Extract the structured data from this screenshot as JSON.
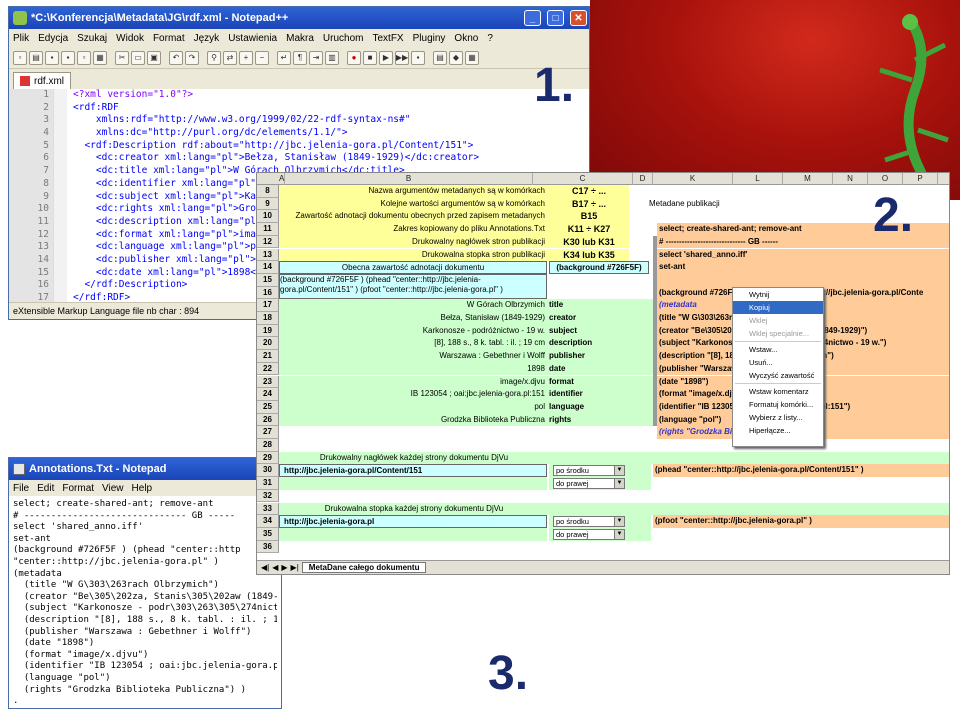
{
  "labels": {
    "n1": "1.",
    "n2": "2.",
    "n3": "3."
  },
  "npp": {
    "title": "*C:\\Konferencja\\Metadata\\JG\\rdf.xml - Notepad++",
    "menu": [
      "Plik",
      "Edycja",
      "Szukaj",
      "Widok",
      "Format",
      "Język",
      "Ustawienia",
      "Makra",
      "Uruchom",
      "TextFX",
      "Pluginy",
      "Okno",
      "?"
    ],
    "tab": "rdf.xml",
    "line_numbers": [
      "1",
      "2",
      "3",
      "4",
      "5",
      "6",
      "7",
      "8",
      "9",
      "10",
      "11",
      "12",
      "13",
      "14",
      "15",
      "16",
      "17"
    ],
    "lines": [
      "<?xml version=\"1.0\"?>",
      "<rdf:RDF",
      "    xmlns:rdf=\"http://www.w3.org/1999/02/22-rdf-syntax-ns#\"",
      "    xmlns:dc=\"http://purl.org/dc/elements/1.1/\">",
      "  <rdf:Description rdf:about=\"http://jbc.jelenia-gora.pl/Content/151\">",
      "    <dc:creator xml:lang=\"pl\">Bełza, Stanisław (1849-1929)</dc:creator>",
      "    <dc:title xml:lang=\"pl\">W Górach Olbrzymich</dc:title>",
      "    <dc:identifier xml:lang=\"pl\">",
      "    <dc:subject xml:lang=\"pl\">Kar",
      "    <dc:rights xml:lang=\"pl\">Grod",
      "    <dc:description xml:lang=\"pl\">",
      "    <dc:format xml:lang=\"pl\">imag",
      "    <dc:language xml:lang=\"pl\">po",
      "    <dc:publisher xml:lang=\"pl\">W",
      "    <dc:date xml:lang=\"pl\">1898</",
      "  </rdf:Description>",
      "</rdf:RDF>"
    ],
    "status": "eXtensible Markup Language file  nb char : 894"
  },
  "np": {
    "title": "Annotations.Txt - Notepad",
    "menu": [
      "File",
      "Edit",
      "Format",
      "View",
      "Help"
    ],
    "lines": [
      "select; create-shared-ant; remove-ant",
      "# ------------------------------ GB -----",
      "select 'shared_anno.iff'",
      "set-ant",
      "(background #726F5F ) (phead \"center::http",
      "\"center::http://jbc.jelenia-gora.pl\" )",
      "(metadata",
      "  (title \"W G\\303\\263rach Olbrzymich\")",
      "  (creator \"Be\\305\\202za, Stanis\\305\\202aw (1849-1929)\")",
      "  (subject \"Karkonosze - podr\\303\\263\\305\\274nictwo - 19 w.\")",
      "  (description \"[8], 188 s., 8 k. tabl. : il. ; 19 cm\")",
      "  (publisher \"Warszawa : Gebethner i Wolff\")",
      "  (date \"1898\")",
      "  (format \"image/x.djvu\")",
      "  (identifier \"IB 123054 ; oai:jbc.jelenia-gora.pl:151\")",
      "  (language \"pol\")",
      "  (rights \"Grodzka Biblioteka Publiczna\") )",
      "."
    ]
  },
  "xl": {
    "cols": [
      "A",
      "B",
      "C",
      "D",
      "J",
      "K",
      "L",
      "M",
      "N",
      "O",
      "P"
    ],
    "rows": [
      "8",
      "9",
      "10",
      "11",
      "12",
      "13",
      "14",
      "15",
      "16",
      "17",
      "18",
      "19",
      "20",
      "21",
      "22",
      "23",
      "24",
      "25",
      "26",
      "27",
      "28",
      "29",
      "30",
      "31",
      "32",
      "33",
      "34",
      "35",
      "36"
    ],
    "yellow_labels": [
      "Nazwa argumentów metadanych są w komórkach",
      "Kolejne wartości argumentów są w komórkach",
      "Zawartość adnotacji dokumentu obecnych przed zapisem metadanych",
      "Zakres kopiowany do pliku Annotations.Txt",
      "Drukowalny nagłówek stron publikacji",
      "Drukowalna stopka stron publikacji"
    ],
    "yellow_values": [
      "C17 ÷ ...",
      "B17 ÷ ...",
      "B15",
      "K11 ÷ K27",
      "K30 lub K31",
      "K34 lub K35"
    ],
    "meta_title": "Metadane publikacji",
    "annot_header": "Obecna zawartość adnotacji dokumentu",
    "annot_bg": "(background #726F5F)",
    "annot_text": "(background #726F5F ) (phead \"center::http://jbc.jelenia-gora.pl/Content/151\" ) (pfoot \"center::http://jbc.jelenia-gora.pl\" )",
    "meta_values": [
      "W Górach Olbrzymich",
      "Bełza, Stanisław (1849-1929)",
      "Karkonosze - podróżnictwo - 19 w.",
      "[8], 188 s., 8 k. tabl. : il. ; 19 cm",
      "Warszawa : Gebethner i Wolff",
      "1898",
      "image/x.djvu",
      "IB 123054 ; oai:jbc.jelenia-gora.pl:151",
      "pol",
      "Grodzka Biblioteka Publiczna"
    ],
    "meta_keys": [
      "title",
      "creator",
      "subject",
      "description",
      "publisher",
      "date",
      "format",
      "identifier",
      "language",
      "rights"
    ],
    "k_lines": [
      "select; create-shared-ant; remove-ant",
      "# ------------------------------ GB ------",
      "select 'shared_anno.iff'",
      "set-ant",
      "",
      "(background #726F5F) (phead \"center::http://jbc.jelenia-gora.pl/Conte",
      "(metadata",
      "(title \"W G\\303\\263rach Olbrzymich\")",
      "(creator \"Be\\305\\202za, Stanis\\305\\202aw (1849-1929)\")",
      "(subject \"Karkonosze - podr\\303\\263\\305\\274nictwo - 19 w.\")",
      "(description \"[8], 188 s., 8 k. tabl. : il. ; 19 cm\")",
      "(publisher \"Warszawa : Gebethner i Wolff\")",
      "(date \"1898\")",
      "(format \"image/x.djvu\")",
      "(identifier \"IB 123054 ; oai:jbc.jelenia-gora.pl:151\")",
      "(language \"pol\")",
      "(rights \"Grodzka Biblioteka Publiczna\") )"
    ],
    "header_label": "Drukowalny nagłówek każdej strony dokumentu DjVu",
    "header_url": "http://jbc.jelenia-gora.pl/Content/151",
    "header_pos": "po środku",
    "header_align": "do prawej",
    "header_result": "(phead \"center::http://jbc.jelenia-gora.pl/Content/151\" )",
    "footer_label": "Drukowalna stopka każdej strony dokumentu DjVu",
    "footer_url": "http://jbc.jelenia-gora.pl",
    "footer_pos": "po środku",
    "footer_align": "do prawej",
    "footer_result": "(pfoot \"center::http://jbc.jelenia-gora.pl\" )",
    "sheet_tab": "MetaDane całego dokumentu",
    "ctx": [
      "Wytnij",
      "Kopiuj",
      "Wklej",
      "Wklej specjalnie...",
      "Wstaw...",
      "Usuń...",
      "Wyczyść zawartość",
      "Wstaw komentarz",
      "Formatuj komórki...",
      "Wybierz z listy...",
      "Hiperłącze..."
    ]
  }
}
